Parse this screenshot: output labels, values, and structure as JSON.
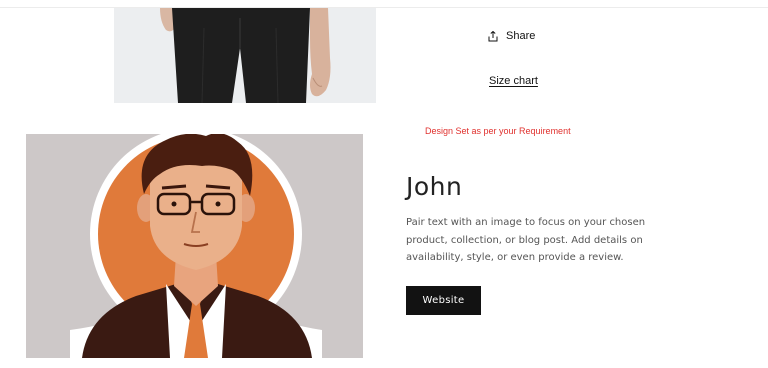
{
  "product": {
    "share_label": "Share",
    "share_icon": "share-upload-icon",
    "size_chart_label": "Size chart"
  },
  "note": {
    "text": "Design Set as per your Requirement",
    "color": "#e0312e"
  },
  "feature": {
    "title": "John",
    "description": "Pair text with an image to focus on your chosen product, collection, or blog post. Add details on availability, style, or even provide a review.",
    "button_label": "Website"
  },
  "colors": {
    "button_bg": "#121212",
    "avatar_orange": "#e07a3a",
    "avatar_bg": "#cdc8c8"
  }
}
